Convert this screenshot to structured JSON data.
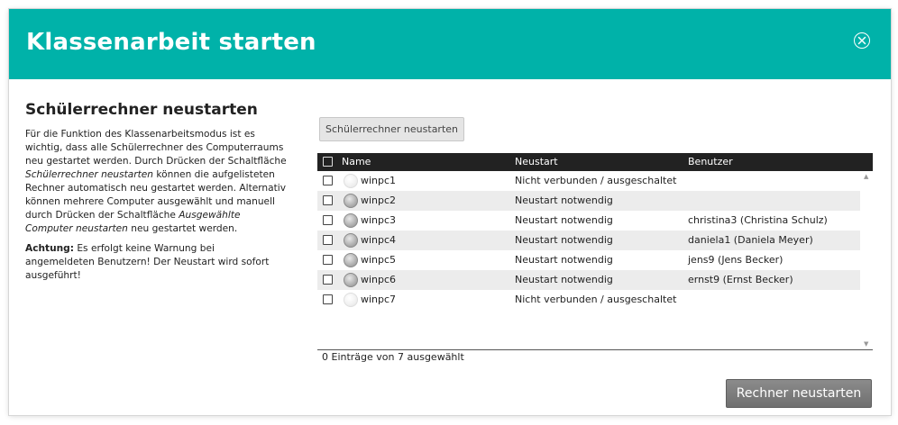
{
  "dialog": {
    "title": "Klassenarbeit starten",
    "close_icon": "close-circle-icon"
  },
  "left": {
    "subtitle": "Schülerrechner neustarten",
    "para1_part1": "Für die Funktion des Klassenarbeitsmodus ist es wichtig, dass alle Schülerrechner des Computerraums neu gestartet werden. Durch Drücken der Schaltfläche ",
    "para1_em1": "Schülerrechner neustarten",
    "para1_part2": " können die aufgelisteten Rechner automatisch neu gestartet werden. Alternativ können mehrere Computer ausgewählt und manuell durch Drücken der Schaltfläche ",
    "para1_em2": "Ausgewählte Computer neustarten",
    "para1_part3": " neu gestartet werden.",
    "warning_label": "Achtung:",
    "warning_text": " Es erfolgt keine Warnung bei angemeldeten Benutzern! Der Neustart wird sofort ausgeführt!"
  },
  "toolbar": {
    "restart_all_label": "Schülerrechner neustarten"
  },
  "grid": {
    "columns": [
      "Name",
      "Neustart",
      "Benutzer"
    ],
    "rows": [
      {
        "name": "winpc1",
        "restart": "Nicht verbunden / ausgeschaltet",
        "user": "",
        "online": false
      },
      {
        "name": "winpc2",
        "restart": "Neustart notwendig",
        "user": "",
        "online": true
      },
      {
        "name": "winpc3",
        "restart": "Neustart notwendig",
        "user": "christina3 (Christina Schulz)",
        "online": true
      },
      {
        "name": "winpc4",
        "restart": "Neustart notwendig",
        "user": "daniela1 (Daniela Meyer)",
        "online": true
      },
      {
        "name": "winpc5",
        "restart": "Neustart notwendig",
        "user": "jens9 (Jens Becker)",
        "online": true
      },
      {
        "name": "winpc6",
        "restart": "Neustart notwendig",
        "user": "ernst9 (Ernst Becker)",
        "online": true
      },
      {
        "name": "winpc7",
        "restart": "Nicht verbunden / ausgeschaltet",
        "user": "",
        "online": false
      }
    ],
    "status": "0 Einträge von 7 ausgewählt"
  },
  "footer": {
    "restart_button_label": "Rechner neustarten"
  },
  "colors": {
    "header": "#00b2a9",
    "grid_header": "#222222",
    "primary_button": "#7a7a7a"
  }
}
